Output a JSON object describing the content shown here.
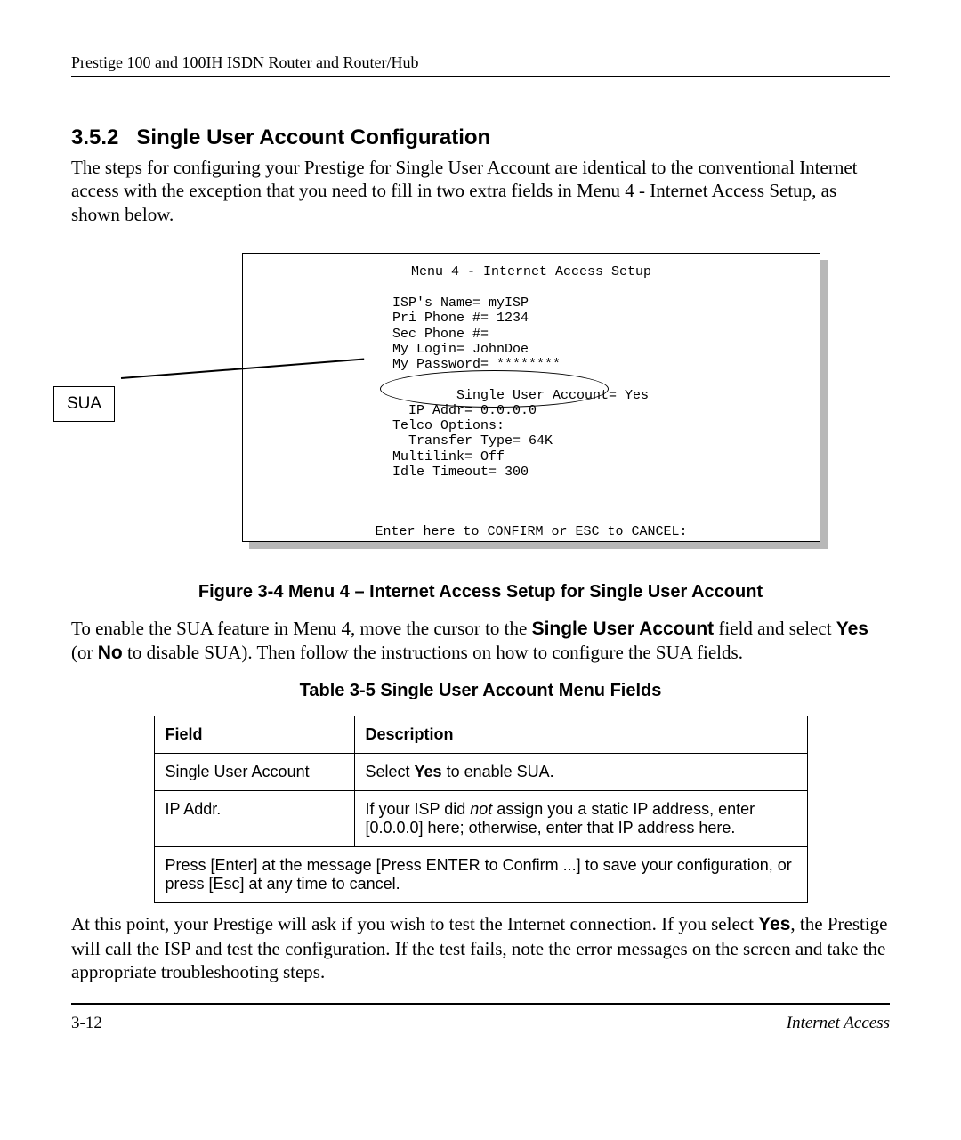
{
  "running_head": "Prestige 100 and 100IH ISDN Router and Router/Hub",
  "section_number": "3.5.2",
  "section_title": "Single User Account Configuration",
  "intro_para": "The steps for configuring your Prestige for Single User Account are identical to the conventional Internet access with the exception that you need to fill in two extra fields in Menu 4 - Internet Access Setup, as shown below.",
  "terminal": {
    "title": "Menu 4 - Internet Access Setup",
    "lines_top": "ISP's Name= myISP\nPri Phone #= 1234\nSec Phone #=\nMy Login= JohnDoe\nMy Password= ********",
    "sua_line1": "Single User Account= Yes",
    "sua_line2": "  IP Addr= 0.0.0.0",
    "lines_bottom": "Telco Options:\n  Transfer Type= 64K\nMultilink= Off\nIdle Timeout= 300",
    "footer": "Enter here to CONFIRM or ESC to CANCEL:"
  },
  "callout_label": "SUA",
  "figure_caption": "Figure 3-4 Menu 4 – Internet Access Setup for Single User Account",
  "enable_para": {
    "p1": "To enable the SUA feature in Menu 4, move the cursor to the ",
    "b1": "Single User Account",
    "p2": " field and select ",
    "b2": "Yes",
    "p3": " (or ",
    "b3": "No",
    "p4": " to disable SUA). Then follow the instructions on how to configure the SUA fields."
  },
  "table_caption": "Table 3-5 Single User Account Menu Fields",
  "table": {
    "h1": "Field",
    "h2": "Description",
    "r1c1": "Single User Account",
    "r1c2_a": "Select ",
    "r1c2_b": "Yes",
    "r1c2_c": " to enable SUA.",
    "r2c1": " IP Addr.",
    "r2c2_a": "If your ISP did ",
    "r2c2_i": "not",
    "r2c2_b": " assign you a static IP address, enter [0.0.0.0] here; otherwise, enter that IP address here.",
    "r3": "Press [Enter] at the message [Press ENTER to Confirm ...] to save your configuration, or press [Esc] at any time to cancel."
  },
  "closing_para": {
    "p1": "At this point, your Prestige will ask if you wish to test the Internet connection. If you select ",
    "b1": "Yes",
    "p2": ", the Prestige will call the ISP and test the configuration.  If the test fails, note the error messages on the screen and take the appropriate troubleshooting steps."
  },
  "footer_left": "3-12",
  "footer_right": "Internet Access"
}
